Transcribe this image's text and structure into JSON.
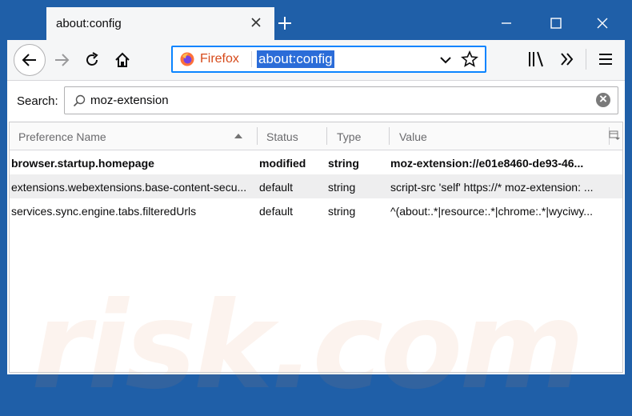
{
  "tab": {
    "title": "about:config"
  },
  "toolbar": {
    "identity_label": "Firefox",
    "url": "about:config"
  },
  "search": {
    "label": "Search:",
    "value": "moz-extension"
  },
  "table": {
    "headers": [
      "Preference Name",
      "Status",
      "Type",
      "Value"
    ],
    "rows": [
      {
        "name": "browser.startup.homepage",
        "status": "modified",
        "type": "string",
        "value": "moz-extension://e01e8460-de93-46..."
      },
      {
        "name": "extensions.webextensions.base-content-secu...",
        "status": "default",
        "type": "string",
        "value": "script-src 'self' https://* moz-extension: ..."
      },
      {
        "name": "services.sync.engine.tabs.filteredUrls",
        "status": "default",
        "type": "string",
        "value": "^(about:.*|resource:.*|chrome:.*|wyciwy..."
      }
    ]
  },
  "watermark": "risk.com",
  "colors": {
    "frame": "#1f5fa8",
    "accent": "#0a84ff",
    "url_select": "#2b6cd8"
  }
}
